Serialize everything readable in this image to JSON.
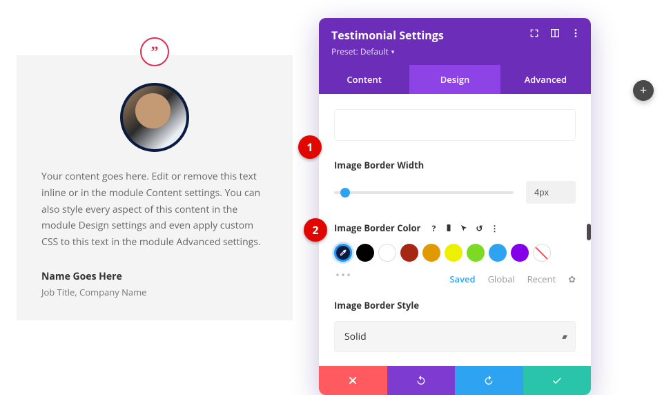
{
  "testimonial": {
    "content": "Your content goes here. Edit or remove this text inline or in the module Content settings. You can also style every aspect of this content in the module Design settings and even apply custom CSS to this text in the module Advanced settings.",
    "name": "Name Goes Here",
    "meta": "Job Title, Company Name",
    "quote_glyph": "”"
  },
  "panel": {
    "title": "Testimonial Settings",
    "preset": "Preset: Default",
    "tabs": {
      "content": "Content",
      "design": "Design",
      "advanced": "Advanced",
      "active": "design"
    },
    "border_width": {
      "label": "Image Border Width",
      "value": "4px"
    },
    "border_color": {
      "label": "Image Border Color",
      "swatches": [
        {
          "name": "eyedropper-selected",
          "color": "#0b1b3f"
        },
        {
          "name": "black",
          "color": "#000000"
        },
        {
          "name": "white",
          "color": "#ffffff"
        },
        {
          "name": "dark-red",
          "color": "#a52714"
        },
        {
          "name": "orange",
          "color": "#e09900"
        },
        {
          "name": "yellow",
          "color": "#edf000"
        },
        {
          "name": "green",
          "color": "#7cda24"
        },
        {
          "name": "blue",
          "color": "#2ea3f2"
        },
        {
          "name": "purple",
          "color": "#8300e9"
        },
        {
          "name": "none",
          "color": ""
        }
      ],
      "subtabs": {
        "saved": "Saved",
        "global": "Global",
        "recent": "Recent",
        "active": "saved"
      }
    },
    "border_style": {
      "label": "Image Border Style",
      "value": "Solid"
    }
  },
  "annotations": {
    "a1": "1",
    "a2": "2"
  },
  "icons": {
    "expand": "expand-icon",
    "layout": "layout-icon",
    "more": "more-icon",
    "help": "?",
    "responsive": "📱",
    "hover": "↖",
    "reset": "↺",
    "kebab": "⋮",
    "plus": "+",
    "gear": "✿",
    "dots": "•••"
  }
}
